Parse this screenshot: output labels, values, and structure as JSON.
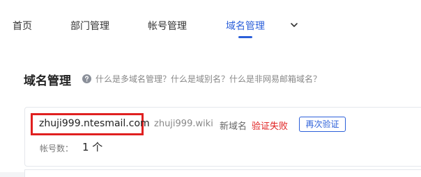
{
  "nav": {
    "tabs": [
      {
        "label": "首页"
      },
      {
        "label": "部门管理"
      },
      {
        "label": "帐号管理"
      },
      {
        "label": "域名管理"
      }
    ],
    "active_index": 3,
    "more_icon": "chevron-down-icon"
  },
  "page": {
    "title": "域名管理",
    "help_icon": "question-circle-icon",
    "help_text": "什么是多域名管理？什么是域别名？什么是非网易邮箱域名？"
  },
  "domain_card": {
    "primary_domain": "zhuji999.ntesmail.com",
    "alias_domain": "zhuji999.wiki",
    "domain_type": "新域名",
    "status_text": "验证失败",
    "reverify_label": "再次验证",
    "account_count_label": "帐号数：",
    "account_count": "1 个"
  },
  "colors": {
    "accent": "#2b5fd9",
    "error": "#e02020",
    "highlight_box": "#e02020"
  }
}
